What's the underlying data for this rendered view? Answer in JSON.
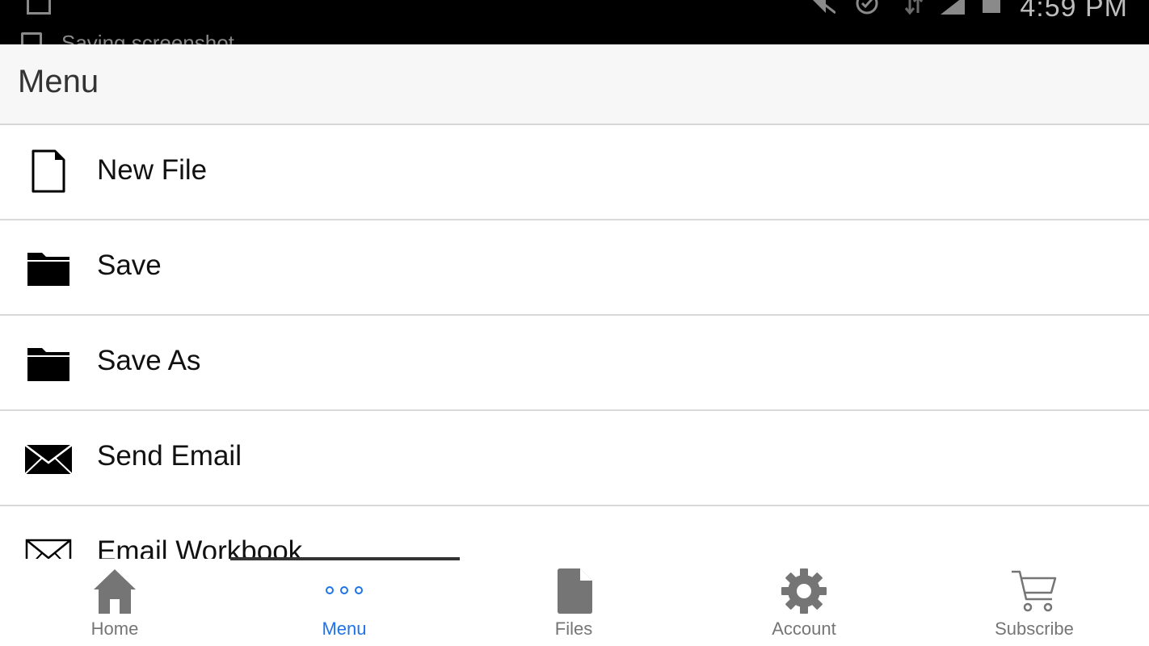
{
  "status_bar": {
    "time": "4:59 PM",
    "notification": "Saving screenshot"
  },
  "header": {
    "title": "Menu"
  },
  "menu": {
    "items": [
      {
        "label": "New File",
        "icon": "document-icon"
      },
      {
        "label": "Save",
        "icon": "folder-icon"
      },
      {
        "label": "Save As",
        "icon": "folder-icon"
      },
      {
        "label": "Send Email",
        "icon": "envelope-icon"
      },
      {
        "label": "Email Workbook",
        "icon": "envelope-outline-icon"
      }
    ]
  },
  "tabs": {
    "active": "Menu",
    "items": [
      {
        "label": "Home",
        "icon": "home-icon"
      },
      {
        "label": "Menu",
        "icon": "more-dots-icon"
      },
      {
        "label": "Files",
        "icon": "file-icon"
      },
      {
        "label": "Account",
        "icon": "gear-icon"
      },
      {
        "label": "Subscribe",
        "icon": "cart-icon"
      }
    ]
  },
  "colors": {
    "accent": "#1e73e8",
    "inactive_tab": "#757575",
    "status_bar": "#000000",
    "header_bg": "#f7f7f7"
  }
}
